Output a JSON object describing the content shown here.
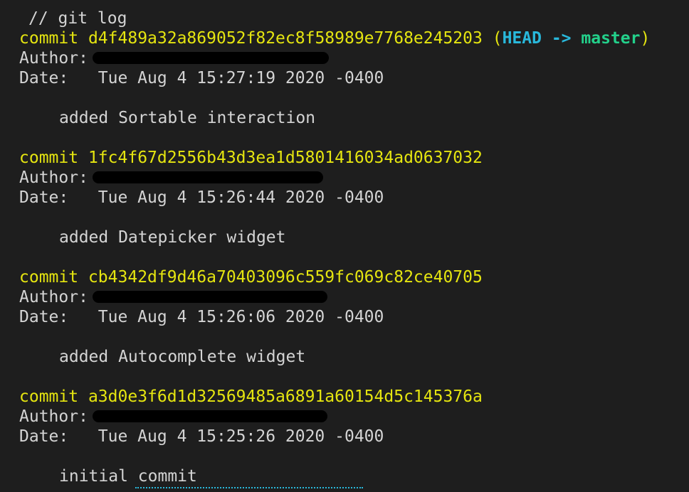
{
  "terminal": {
    "command": "// git log",
    "commits": [
      {
        "keyword": "commit",
        "hash": "d4f489a32a869052f82ec8f58989e7768e245203",
        "refs": {
          "open": "(",
          "head": "HEAD",
          "arrow": "->",
          "branch": "master",
          "close": ")"
        },
        "author_label": "Author:",
        "date_label": "Date:",
        "date": "Tue Aug 4 15:27:19 2020 -0400",
        "message": "added Sortable interaction"
      },
      {
        "keyword": "commit",
        "hash": "1fc4f67d2556b43d3ea1d5801416034ad0637032",
        "author_label": "Author:",
        "date_label": "Date:",
        "date": "Tue Aug 4 15:26:44 2020 -0400",
        "message": "added Datepicker widget"
      },
      {
        "keyword": "commit",
        "hash": "cb4342df9d46a70403096c559fc069c82ce40705",
        "author_label": "Author:",
        "date_label": "Date:",
        "date": "Tue Aug 4 15:26:06 2020 -0400",
        "message": "added Autocomplete widget"
      },
      {
        "keyword": "commit",
        "hash": "a3d0e3f6d1d32569485a6891a60154d5c145376a",
        "author_label": "Author:",
        "date_label": "Date:",
        "date": "Tue Aug 4 15:25:26 2020 -0400",
        "message": "initial commit"
      }
    ]
  },
  "colors": {
    "background": "#1e1e1e",
    "text": "#d4d4d4",
    "commit": "#e5e510",
    "head": "#29b8db",
    "branch": "#23d18b",
    "redaction": "#000000"
  }
}
